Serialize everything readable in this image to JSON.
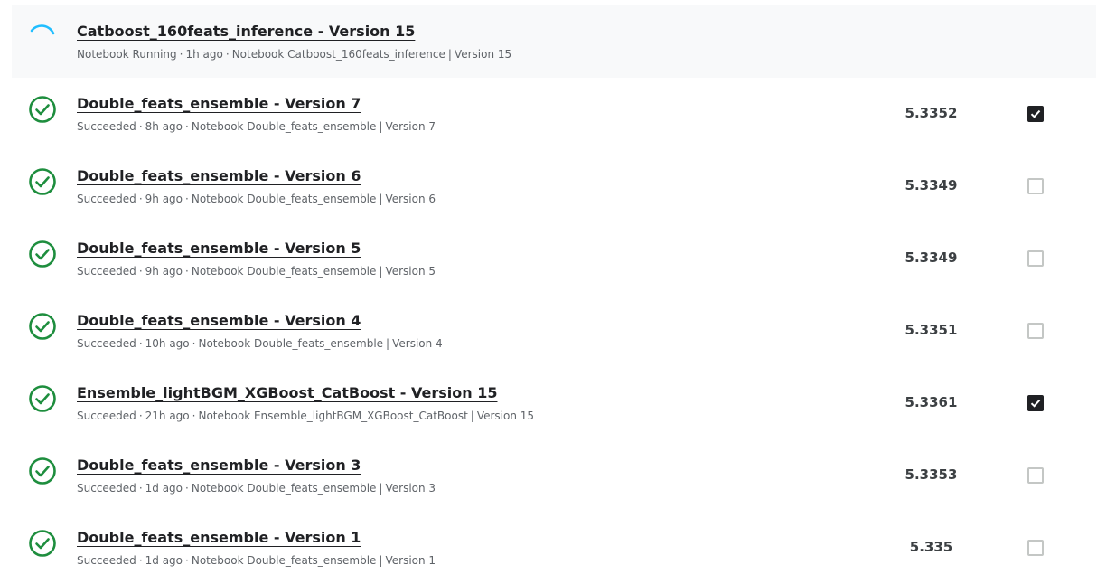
{
  "colors": {
    "success": "#1e8e3e",
    "running_spinner": "#20beff",
    "checkbox_checked": "#202124"
  },
  "submissions": [
    {
      "status_icon": "spinner-icon",
      "status": "running",
      "title": "Catboost_160feats_inference - Version 15",
      "status_text": "Notebook Running",
      "time": "1h ago",
      "notebook": "Notebook Catboost_160feats_inference",
      "version": "Version 15",
      "score": "",
      "selected": null
    },
    {
      "status_icon": "check-circle-icon",
      "status": "succeeded",
      "title": "Double_feats_ensemble - Version 7",
      "status_text": "Succeeded",
      "time": "8h ago",
      "notebook": "Notebook Double_feats_ensemble",
      "version": "Version 7",
      "score": "5.3352",
      "selected": true
    },
    {
      "status_icon": "check-circle-icon",
      "status": "succeeded",
      "title": "Double_feats_ensemble - Version 6",
      "status_text": "Succeeded",
      "time": "9h ago",
      "notebook": "Notebook Double_feats_ensemble",
      "version": "Version 6",
      "score": "5.3349",
      "selected": false
    },
    {
      "status_icon": "check-circle-icon",
      "status": "succeeded",
      "title": "Double_feats_ensemble - Version 5",
      "status_text": "Succeeded",
      "time": "9h ago",
      "notebook": "Notebook Double_feats_ensemble",
      "version": "Version 5",
      "score": "5.3349",
      "selected": false
    },
    {
      "status_icon": "check-circle-icon",
      "status": "succeeded",
      "title": "Double_feats_ensemble - Version 4",
      "status_text": "Succeeded",
      "time": "10h ago",
      "notebook": "Notebook Double_feats_ensemble",
      "version": "Version 4",
      "score": "5.3351",
      "selected": false
    },
    {
      "status_icon": "check-circle-icon",
      "status": "succeeded",
      "title": "Ensemble_lightBGM_XGBoost_CatBoost - Version 15",
      "status_text": "Succeeded",
      "time": "21h ago",
      "notebook": "Notebook Ensemble_lightBGM_XGBoost_CatBoost",
      "version": "Version 15",
      "score": "5.3361",
      "selected": true
    },
    {
      "status_icon": "check-circle-icon",
      "status": "succeeded",
      "title": "Double_feats_ensemble - Version 3",
      "status_text": "Succeeded",
      "time": "1d ago",
      "notebook": "Notebook Double_feats_ensemble",
      "version": "Version 3",
      "score": "5.3353",
      "selected": false
    },
    {
      "status_icon": "check-circle-icon",
      "status": "succeeded",
      "title": "Double_feats_ensemble - Version 1",
      "status_text": "Succeeded",
      "time": "1d ago",
      "notebook": "Notebook Double_feats_ensemble",
      "version": "Version 1",
      "score": "5.335",
      "selected": false
    }
  ]
}
